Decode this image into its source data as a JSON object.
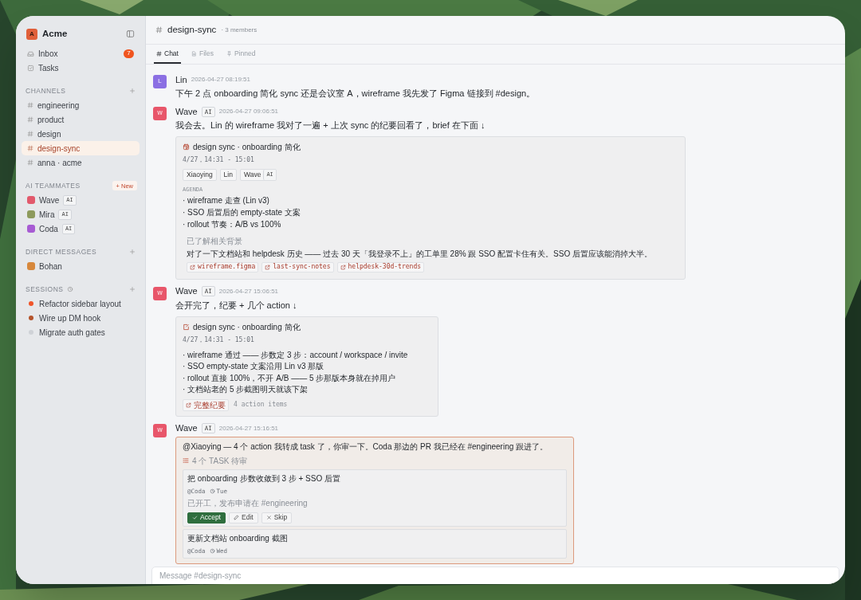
{
  "workspace": {
    "initial": "A",
    "name": "Acme"
  },
  "nav": [
    {
      "kind": "inbox",
      "label": "Inbox",
      "badge": "7"
    },
    {
      "kind": "tasks",
      "label": "Tasks"
    }
  ],
  "channels": {
    "title": "CHANNELS",
    "items": [
      {
        "label": "engineering",
        "selected": false
      },
      {
        "label": "product",
        "selected": false
      },
      {
        "label": "design",
        "selected": false
      },
      {
        "label": "design-sync",
        "selected": true
      },
      {
        "label": "anna · acme",
        "selected": false
      }
    ]
  },
  "ai_teammates": {
    "title": "AI TEAMMATES",
    "new_button": "+ New",
    "items": [
      {
        "name": "Wave",
        "tag": "AI",
        "color": "#e2596c"
      },
      {
        "name": "Mira",
        "tag": "AI",
        "color": "#8d9a5c"
      },
      {
        "name": "Coda",
        "tag": "AI",
        "color": "#a75bd3"
      }
    ]
  },
  "direct_messages": {
    "title": "DIRECT MESSAGES",
    "items": [
      {
        "name": "Bohan",
        "color": "#d7883c"
      }
    ]
  },
  "sessions": {
    "title": "SESSIONS",
    "items": [
      {
        "label": "Refactor sidebar layout",
        "color": "#f0552a"
      },
      {
        "label": "Wire up DM hook",
        "color": "#b4532b"
      },
      {
        "label": "Migrate auth gates",
        "color": "#cfd2d7"
      }
    ]
  },
  "channel_header": {
    "name": "design-sync",
    "members": "· 3 members"
  },
  "tabs": [
    {
      "kind": "hash",
      "label": "Chat",
      "selected": true
    },
    {
      "kind": "file",
      "label": "Files",
      "selected": false
    },
    {
      "kind": "pin",
      "label": "Pinned",
      "selected": false
    }
  ],
  "messages": [
    {
      "author": "Lin",
      "initial": "L",
      "color": "#8b6fe3",
      "time": "2026-04-27 08:19:51",
      "text": "下午 2 点 onboarding 简化 sync 还是会议室 A，wireframe 我先发了 Figma 链接到 #design。"
    },
    {
      "author": "Wave",
      "initial": "W",
      "color": "#e8566a",
      "tag": "AI",
      "time": "2026-04-27 09:06:51",
      "text": "我会去。Lin 的 wireframe 我对了一遍 + 上次 sync 的纪要回看了，brief 在下面 ↓",
      "card": {
        "kind": "brief",
        "title": "design sync · onboarding 简化",
        "time": "4/27，14:31 - 15:01",
        "participants": [
          {
            "name": "Xiaoying"
          },
          {
            "name": "Lin"
          },
          {
            "name": "Wave",
            "tag": "AI"
          }
        ],
        "agenda_label": "AGENDA",
        "agenda": [
          "· wireframe 走查 (Lin v3)",
          "· SSO 后置后的 empty-state 文案",
          "· rollout 节奏：A/B vs 100%"
        ],
        "context_label": "已了解相关背景",
        "context": "对了一下文档站和 helpdesk 历史 —— 过去 30 天「我登录不上」的工单里 28% 跟 SSO 配置卡住有关。SSO 后置应该能消掉大半。",
        "links": [
          "wireframe.figma",
          "last-sync-notes",
          "helpdesk-30d-trends"
        ]
      }
    },
    {
      "author": "Wave",
      "initial": "W",
      "color": "#e8566a",
      "tag": "AI",
      "time": "2026-04-27 15:06:51",
      "text": "会开完了，纪要 + 几个 action ↓",
      "card": {
        "kind": "minutes",
        "title": "design sync · onboarding 简化",
        "time": "4/27，14:31 - 15:01",
        "items": [
          "· wireframe 通过 —— 步数定 3 步：account / workspace / invite",
          "· SSO empty-state 文案沿用 Lin v3 那版",
          "· rollout 直接 100%，不开 A/B —— 5 步那版本身就在掉用户",
          "· 文档站老的 5 步截图明天就该下架"
        ],
        "link": "完整纪要",
        "note": "4 action items"
      }
    },
    {
      "author": "Wave",
      "initial": "W",
      "color": "#e8566a",
      "tag": "AI",
      "time": "2026-04-27 15:16:51",
      "card": {
        "kind": "tasks",
        "text": "@Xiaoying — 4 个 action 我转成 task 了，你审一下。Coda 那边的 PR 我已经在 #engineering 跟进了。",
        "count_label": "4 个 TASK 待审",
        "tasks": [
          {
            "title": "把 onboarding 步数收敛到 3 步 + SSO 后置",
            "assignee": "@Coda",
            "due": "Tue",
            "note": "已开工，发布申请在 #engineering",
            "actions": [
              {
                "kind": "accept",
                "label": "Accept"
              },
              {
                "kind": "edit",
                "label": "Edit"
              },
              {
                "kind": "skip",
                "label": "Skip"
              }
            ]
          },
          {
            "title": "更新文档站 onboarding 截图",
            "assignee": "@Coda",
            "due": "Wed"
          }
        ]
      }
    }
  ],
  "composer": {
    "placeholder": "Message #design-sync"
  }
}
